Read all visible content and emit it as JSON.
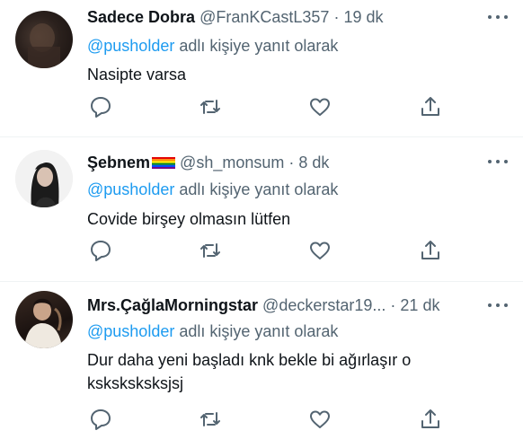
{
  "tweets": [
    {
      "name": "Sadece Dobra",
      "handle": "@FranKCastL357",
      "sep": "·",
      "time": "19 dk",
      "reply_mention": "@pusholder",
      "reply_suffix": " adlı kişiye yanıt olarak",
      "text": "Nasipte varsa"
    },
    {
      "name": "Şebnem",
      "handle": "@sh_monsum",
      "sep": "·",
      "time": "8 dk",
      "reply_mention": "@pusholder",
      "reply_suffix": " adlı kişiye yanıt olarak",
      "text": "Covide birşey olmasın lütfen"
    },
    {
      "name": "Mrs.ÇağlaMorningstar",
      "handle": "@deckerstar19...",
      "sep": "·",
      "time": "21 dk",
      "reply_mention": "@pusholder",
      "reply_suffix": " adlı kişiye yanıt olarak",
      "text": "Dur daha yeni başladı knk bekle bi ağırlaşır o ksksksksksjsj"
    }
  ],
  "icons": {
    "reply": "reply-icon",
    "retweet": "retweet-icon",
    "like": "heart-icon",
    "share": "share-icon",
    "more": "more-icon"
  },
  "colors": {
    "link": "#1d9bf0",
    "muted": "#536471",
    "text": "#0f1419",
    "divider": "#eff3f4"
  }
}
